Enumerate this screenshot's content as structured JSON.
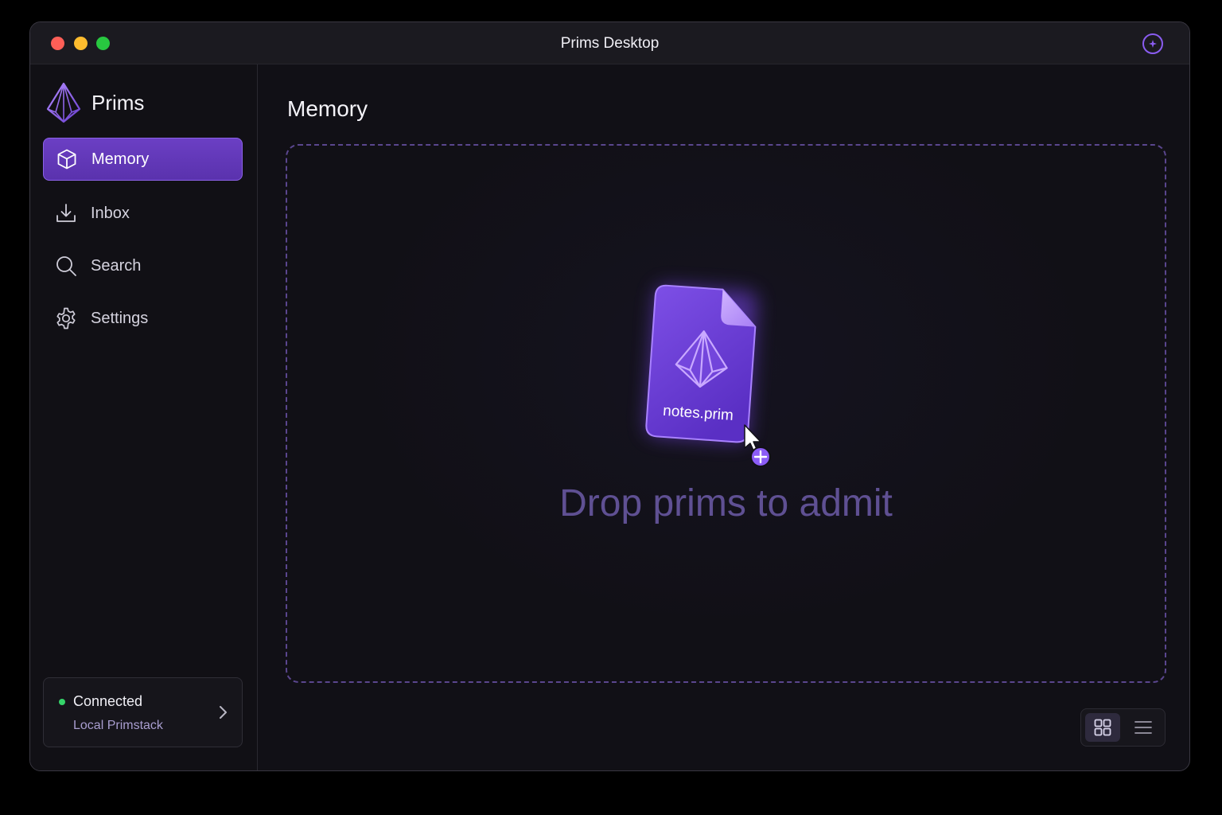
{
  "window": {
    "title": "Prims Desktop",
    "icons": {
      "status": "sparkle-circle-icon"
    }
  },
  "sidebar": {
    "brand": {
      "name": "Prims",
      "icon": "prism-logo-icon"
    },
    "items": [
      {
        "label": "Memory",
        "icon": "cube-icon",
        "active": true
      },
      {
        "label": "Inbox",
        "icon": "download-tray-icon",
        "active": false
      },
      {
        "label": "Search",
        "icon": "search-icon",
        "active": false
      },
      {
        "label": "Settings",
        "icon": "gear-icon",
        "active": false
      }
    ],
    "connection": {
      "status": "Connected",
      "target": "Local Primstack",
      "status_color": "#35d46a"
    }
  },
  "main": {
    "title": "Memory",
    "dropzone": {
      "message": "Drop prims to admit",
      "dragged_file": "notes.prim"
    },
    "view_toggle": {
      "options": [
        "grid",
        "list"
      ],
      "selected": "grid"
    }
  },
  "colors": {
    "accent": "#6b3fc4",
    "accent_light": "#9b6cf5",
    "background": "#111016"
  }
}
